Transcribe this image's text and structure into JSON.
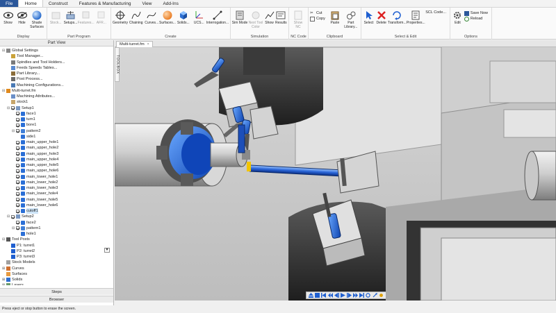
{
  "menu": {
    "tabs": [
      {
        "label": "File"
      },
      {
        "label": "Home"
      },
      {
        "label": "Construct"
      },
      {
        "label": "Features & Manufacturing"
      },
      {
        "label": "View"
      },
      {
        "label": "Add-Ins"
      }
    ]
  },
  "ribbon": {
    "display": {
      "label": "Display",
      "show": "Show",
      "hide": "Hide",
      "shade": "Shade Surfaces"
    },
    "part_program": {
      "label": "Part Program",
      "stock": "Stock...",
      "setups": "Setups...",
      "features": "Features...",
      "afr": "AFR..."
    },
    "create": {
      "label": "Create",
      "geometry": "Geometry",
      "chaining": "Chaining",
      "curves": "Curves...",
      "surfaces": "Surfaces...",
      "solids": "Solids...",
      "ucs": "UCS...",
      "interrogation": "Interrogation..."
    },
    "simulation": {
      "label": "Simulation",
      "sim_mode": "Sim Mode",
      "next_tool": "Next Tool Color",
      "show": "Show",
      "results": "Results"
    },
    "nc_code": {
      "label": "NC Code",
      "show_nc": "Show NC"
    },
    "clipboard": {
      "label": "Clipboard",
      "cut": "Cut",
      "copy": "Copy",
      "paste": "Paste",
      "part_library": "Part Library..."
    },
    "select_edit": {
      "label": "Select & Edit",
      "select": "Select",
      "delete": "Delete",
      "transform": "Transform...",
      "properties": "Properties...",
      "scl_code": "SCL Code..."
    },
    "options": {
      "label": "Options",
      "edit": "Edit",
      "save_now": "Save Now",
      "reload": "Reload"
    }
  },
  "part_view": {
    "title": "Part View",
    "tree": [
      {
        "text": "Global Settings",
        "level": 0,
        "exp": "minus",
        "icon": "gear"
      },
      {
        "text": "Tool Manager...",
        "level": 1,
        "icon": "tool"
      },
      {
        "text": "Spindles and Tool Holders...",
        "level": 1,
        "icon": "spindle"
      },
      {
        "text": "Feeds  Speeds Tables...",
        "level": 1,
        "icon": "table"
      },
      {
        "text": "Part Library...",
        "level": 1,
        "icon": "lib"
      },
      {
        "text": "Post Process...",
        "level": 1,
        "icon": "post"
      },
      {
        "text": "Machining Configurations...",
        "level": 1,
        "icon": "config"
      },
      {
        "text": "Multi-turret.fm",
        "level": 0,
        "exp": "minus",
        "icon": "file"
      },
      {
        "text": "Machining Attributes...",
        "level": 1,
        "icon": "attr"
      },
      {
        "text": "stock1",
        "level": 1,
        "icon": "stock"
      },
      {
        "text": "Setup1",
        "level": 1,
        "exp": "minus",
        "cb": true,
        "icon": "setup"
      },
      {
        "text": "face1",
        "level": 2,
        "cb": true,
        "icon": "feat"
      },
      {
        "text": "turn1",
        "level": 2,
        "cb": true,
        "icon": "feat"
      },
      {
        "text": "bore1",
        "level": 2,
        "cb": true,
        "icon": "feat"
      },
      {
        "text": "pattern2",
        "level": 2,
        "exp": "minus",
        "cb": true,
        "icon": "pattern"
      },
      {
        "text": "side1",
        "level": 3,
        "icon": "feat"
      },
      {
        "text": "main_upper_hole1",
        "level": 2,
        "cb": true,
        "icon": "feat"
      },
      {
        "text": "main_upper_hole2",
        "level": 2,
        "cb": true,
        "icon": "feat"
      },
      {
        "text": "main_upper_hole3",
        "level": 2,
        "cb": true,
        "icon": "feat"
      },
      {
        "text": "main_upper_hole4",
        "level": 2,
        "cb": true,
        "icon": "feat"
      },
      {
        "text": "main_upper_hole5",
        "level": 2,
        "cb": true,
        "icon": "feat"
      },
      {
        "text": "main_upper_hole6",
        "level": 2,
        "cb": true,
        "icon": "feat"
      },
      {
        "text": "main_lower_hole1",
        "level": 2,
        "cb": true,
        "icon": "feat"
      },
      {
        "text": "main_lower_hole2",
        "level": 2,
        "cb": true,
        "icon": "feat"
      },
      {
        "text": "main_lower_hole3",
        "level": 2,
        "cb": true,
        "icon": "feat"
      },
      {
        "text": "main_lower_hole4",
        "level": 2,
        "cb": true,
        "icon": "feat"
      },
      {
        "text": "main_lower_hole5",
        "level": 2,
        "cb": true,
        "icon": "feat"
      },
      {
        "text": "main_lower_hole6",
        "level": 2,
        "cb": true,
        "icon": "feat"
      },
      {
        "text": "cutoff1",
        "level": 2,
        "cb": true,
        "icon": "feat",
        "sel": true
      },
      {
        "text": "Setup2",
        "level": 1,
        "exp": "minus",
        "cb": true,
        "icon": "setup"
      },
      {
        "text": "face2",
        "level": 2,
        "cb": true,
        "icon": "feat"
      },
      {
        "text": "pattern1",
        "level": 2,
        "exp": "minus",
        "cb": true,
        "icon": "pattern"
      },
      {
        "text": "hole1",
        "level": 3,
        "icon": "feat"
      },
      {
        "text": "Tool Posts",
        "level": 0,
        "exp": "minus",
        "icon": "toolpost"
      },
      {
        "text": "P1: turret1",
        "level": 1,
        "icon": "turret"
      },
      {
        "text": "P2: turret2",
        "level": 1,
        "icon": "turret"
      },
      {
        "text": "P3: turret3",
        "level": 1,
        "icon": "turret"
      },
      {
        "text": "Stock Models",
        "level": 0,
        "icon": "stockmodel"
      },
      {
        "text": "Curves",
        "level": 0,
        "exp": "plus",
        "icon": "curves"
      },
      {
        "text": "Surfaces",
        "level": 0,
        "icon": "surfaces"
      },
      {
        "text": "Solids",
        "level": 0,
        "exp": "plus",
        "icon": "solids"
      },
      {
        "text": "Layers",
        "level": 0,
        "exp": "plus",
        "icon": "layers"
      }
    ],
    "steps_tab": "Steps",
    "browser_tab": "Browser"
  },
  "status": {
    "text": "Press eject or stop button to erase the screen."
  },
  "document": {
    "tab_title": "Multi-turret.fm",
    "close": "×"
  },
  "toolbox": {
    "label": "TOOLBOX"
  },
  "colors": {
    "accent": "#2b579a",
    "tool_blue": "#1f5fd0",
    "machine_gray": "#7a7a7a",
    "viewport_bg": "#e9e9e9"
  }
}
